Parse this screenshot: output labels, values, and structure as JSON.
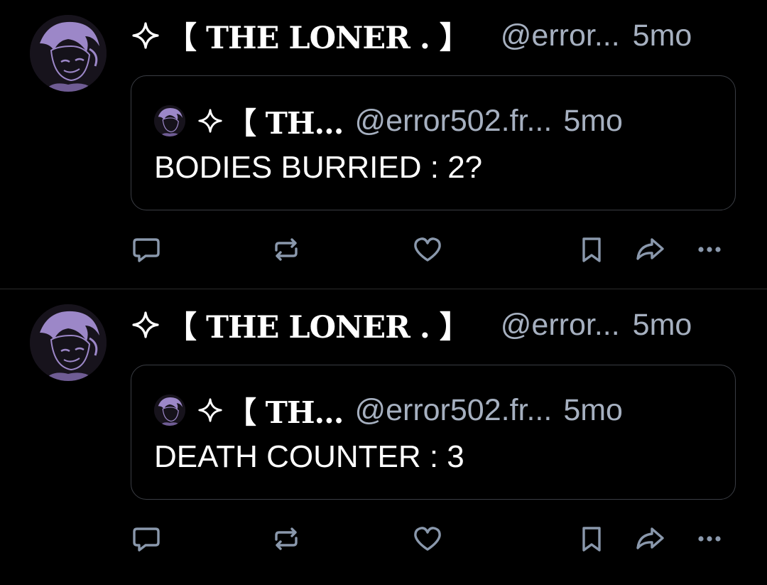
{
  "feed": {
    "posts": [
      {
        "author": {
          "display_name": "【 THE LONER . 】",
          "handle": "@error...",
          "time": "5mo"
        },
        "quote": {
          "display_name": "【 TH...",
          "handle": "@error502.fr...",
          "time": "5mo",
          "text": "BODIES BURRIED : 2?"
        }
      },
      {
        "author": {
          "display_name": "【 THE LONER . 】",
          "handle": "@error...",
          "time": "5mo"
        },
        "quote": {
          "display_name": "【 TH...",
          "handle": "@error502.fr...",
          "time": "5mo",
          "text": "DEATH COUNTER : 3"
        }
      }
    ]
  },
  "icons": {
    "reply": "speech-bubble-icon",
    "repost": "repost-arrows-icon",
    "like": "heart-icon",
    "bookmark": "bookmark-icon",
    "share": "share-arrow-icon",
    "more": "ellipsis-icon",
    "sparkle": "four-point-star-icon"
  },
  "colors": {
    "background": "#000000",
    "text_primary": "#ffffff",
    "text_secondary": "#a6b0c0",
    "icon": "#8a98ac",
    "border": "#3a3d44",
    "avatar_accent": "#9c87c8"
  }
}
